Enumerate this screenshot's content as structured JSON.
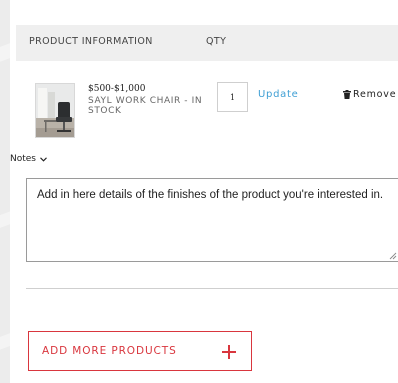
{
  "cart": {
    "header": {
      "product_info": "PRODUCT INFORMATION",
      "qty": "QTY"
    },
    "item": {
      "price": "$500-$1,000",
      "name": "SAYL WORK CHAIR - IN STOCK",
      "quantity": "1",
      "update_label": "Update",
      "remove_label": "Remove",
      "remove_icon": "trash-icon"
    }
  },
  "notes": {
    "label": "Notes",
    "toggle_icon": "chevron-down-icon",
    "value": "Add in here details of the finishes of the product you're interested in."
  },
  "actions": {
    "add_more_label": "ADD MORE PRODUCTS",
    "add_more_icon": "plus-icon"
  },
  "colors": {
    "accent_red": "#d9363e",
    "link_blue": "#3f9fd4",
    "header_bg": "#efefef"
  }
}
